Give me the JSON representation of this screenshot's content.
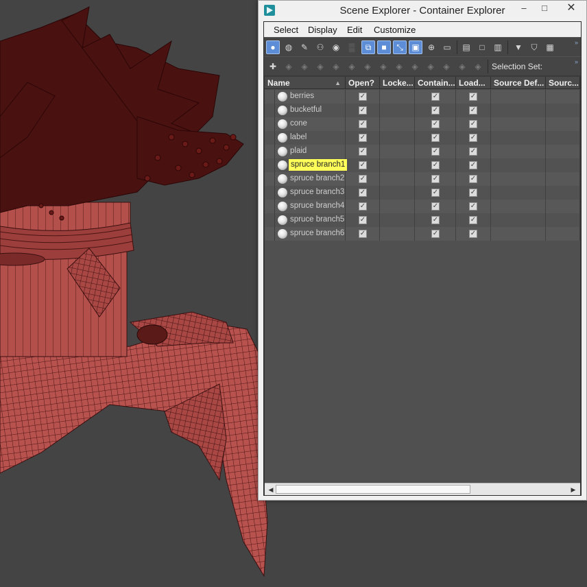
{
  "window": {
    "title": "Scene Explorer - Container Explorer",
    "controls": {
      "minimize": "–",
      "maximize": "□",
      "close": "✕"
    }
  },
  "menu": [
    "Select",
    "Display",
    "Edit",
    "Customize"
  ],
  "toolbar1": {
    "icons": [
      "select-all-icon",
      "select-none-icon",
      "select-invert-icon",
      "display-geometry-icon",
      "display-shapes-icon",
      "display-lights-icon",
      "display-cameras-icon",
      "display-helpers-icon",
      "display-spacewarps-icon",
      "display-groups-icon",
      "display-xrefs-icon",
      "display-bones-icon",
      "display-containers-icon",
      "list-view-icon",
      "table-view-icon",
      "columns-icon",
      "filter-icon",
      "filter-edit-icon",
      "layer-icon"
    ]
  },
  "toolbar2": {
    "icons": [
      "container-create-icon",
      "container-add-icon",
      "container-inherit-icon",
      "container-merge-icon",
      "container-close-icon",
      "container-open-icon",
      "container-edit-icon",
      "container-save-icon",
      "container-reload-icon",
      "container-update-icon",
      "container-unload-icon",
      "container-lock-icon",
      "container-unlock-icon",
      "container-make-unique-icon"
    ],
    "selection_set_label": "Selection Set:"
  },
  "table": {
    "columns": [
      "Name",
      "Open?",
      "Locke...",
      "Contain...",
      "Load...",
      "Source Def...",
      "Sourc..."
    ],
    "rows": [
      {
        "name": "berries",
        "open": true,
        "locked": false,
        "contains": true,
        "loaded": true,
        "selected": false
      },
      {
        "name": "bucketful",
        "open": true,
        "locked": false,
        "contains": true,
        "loaded": true,
        "selected": false
      },
      {
        "name": "cone",
        "open": true,
        "locked": false,
        "contains": true,
        "loaded": true,
        "selected": false
      },
      {
        "name": "label",
        "open": true,
        "locked": false,
        "contains": true,
        "loaded": true,
        "selected": false
      },
      {
        "name": "plaid",
        "open": true,
        "locked": false,
        "contains": true,
        "loaded": true,
        "selected": false
      },
      {
        "name": "spruce branch1",
        "open": true,
        "locked": false,
        "contains": true,
        "loaded": true,
        "selected": true
      },
      {
        "name": "spruce branch2",
        "open": true,
        "locked": false,
        "contains": true,
        "loaded": true,
        "selected": false
      },
      {
        "name": "spruce branch3",
        "open": true,
        "locked": false,
        "contains": true,
        "loaded": true,
        "selected": false
      },
      {
        "name": "spruce branch4",
        "open": true,
        "locked": false,
        "contains": true,
        "loaded": true,
        "selected": false
      },
      {
        "name": "spruce branch5",
        "open": true,
        "locked": false,
        "contains": true,
        "loaded": true,
        "selected": false
      },
      {
        "name": "spruce branch6",
        "open": true,
        "locked": false,
        "contains": true,
        "loaded": true,
        "selected": false
      }
    ]
  },
  "colors": {
    "viewport_bg": "#444444",
    "mesh_red": "#b24a4a",
    "selection_yellow": "#ffff5a",
    "active_button": "#5c8dd6"
  }
}
